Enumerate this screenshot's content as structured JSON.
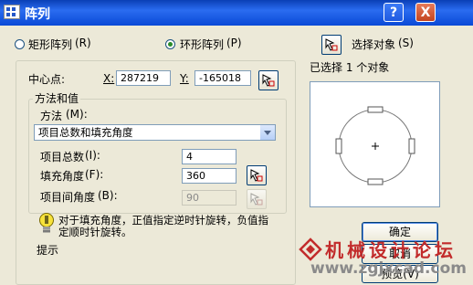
{
  "window": {
    "title": "阵列",
    "help_label": "?",
    "close_label": "X"
  },
  "mode": {
    "rect_label": "矩形阵列",
    "rect_key": "(R)",
    "polar_label": "环形阵列",
    "polar_key": "(P)",
    "selected": "polar"
  },
  "select_objects": {
    "button_label": "选择对象",
    "key": "(S)",
    "status": "已选择 1 个对象"
  },
  "center": {
    "label": "中心点:",
    "x_label": "X:",
    "x_value": "287219",
    "y_label": "Y:",
    "y_value": "-165018"
  },
  "method_group": {
    "title": "方法和值",
    "method_label": "方法",
    "method_key": "(M):",
    "method_value": "项目总数和填充角度",
    "total_items_label": "项目总数",
    "total_items_key": "(I):",
    "total_items_value": "4",
    "fill_angle_label": "填充角度",
    "fill_angle_key": "(F):",
    "fill_angle_value": "360",
    "angle_between_label": "项目间角度",
    "angle_between_key": "(B):",
    "angle_between_value": "90"
  },
  "tip": {
    "text": "对于填充角度，正值指定逆时针旋转，负值指定顺时针旋转。",
    "label": "提示"
  },
  "buttons": {
    "ok": "确定",
    "cancel": "取消",
    "preview": "预览(V)"
  },
  "watermark": {
    "text": "机械设计论坛",
    "url": "www.zgjxcad.com"
  },
  "colors": {
    "title_bar": "#0a49d6",
    "dialog_bg": "#ece9d8",
    "watermark_red": "#c22b2b"
  }
}
